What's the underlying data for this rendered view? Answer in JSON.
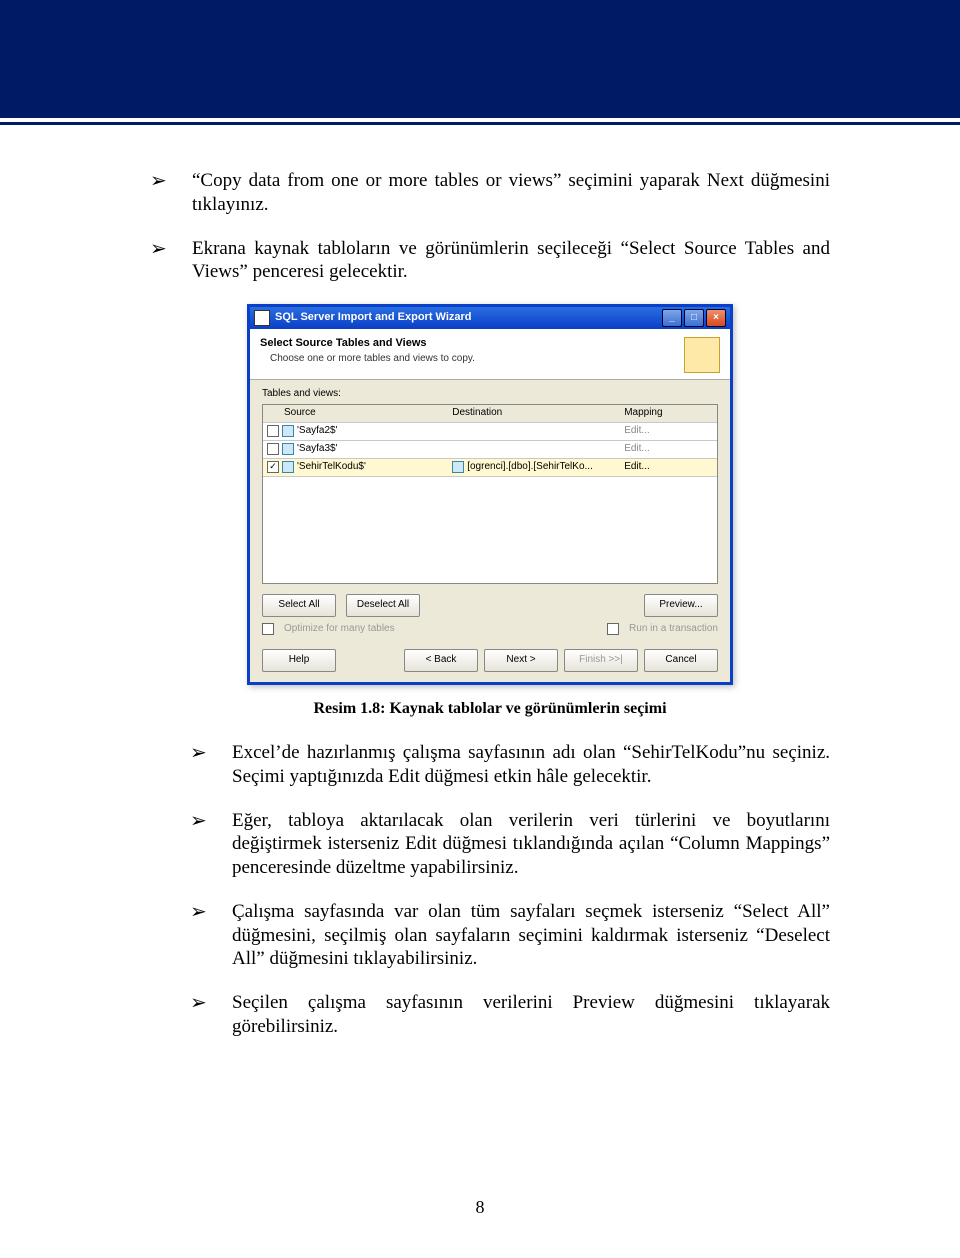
{
  "bullets_top": [
    "“Copy data from one or more tables or views” seçimini yaparak Next düğmesini tıklayınız.",
    "Ekrana kaynak tabloların ve görünümlerin seçileceği “Select Source Tables and Views” penceresi gelecektir."
  ],
  "wizard": {
    "title": "SQL Server Import and Export Wizard",
    "head_title": "Select Source Tables and Views",
    "head_sub": "Choose one or more tables and views to copy.",
    "tables_label": "Tables and views:",
    "columns": {
      "source": "Source",
      "destination": "Destination",
      "mapping": "Mapping"
    },
    "rows": [
      {
        "checked": false,
        "source": "'Sayfa2$'",
        "destination": "",
        "mapping": "Edit..."
      },
      {
        "checked": false,
        "source": "'Sayfa3$'",
        "destination": "",
        "mapping": "Edit..."
      },
      {
        "checked": true,
        "source": "'SehirTelKodu$'",
        "destination": "[ogrenci].[dbo].[SehirTelKo...",
        "mapping": "Edit..."
      }
    ],
    "buttons": {
      "select_all": "Select All",
      "deselect_all": "Deselect All",
      "preview": "Preview...",
      "optimize": "Optimize for many tables",
      "run_tx": "Run in a transaction",
      "help": "Help",
      "back": "< Back",
      "next": "Next >",
      "finish": "Finish >>|",
      "cancel": "Cancel"
    }
  },
  "caption": "Resim 1.8: Kaynak tablolar ve görünümlerin seçimi",
  "bullets_bottom": [
    "Excel’de hazırlanmış çalışma sayfasının adı olan “SehirTelKodu”nu seçiniz. Seçimi yaptığınızda Edit düğmesi etkin hâle gelecektir.",
    "Eğer, tabloya aktarılacak olan verilerin veri türlerini ve boyutlarını değiştirmek isterseniz Edit düğmesi tıklandığında açılan “Column Mappings” penceresinde düzeltme yapabilirsiniz.",
    "Çalışma sayfasında var olan tüm sayfaları seçmek isterseniz “Select All” düğmesini, seçilmiş olan sayfaların seçimini kaldırmak isterseniz “Deselect All” düğmesini tıklayabilirsiniz.",
    "Seçilen çalışma sayfasının verilerini Preview düğmesini tıklayarak görebilirsiniz."
  ],
  "page_number": "8"
}
